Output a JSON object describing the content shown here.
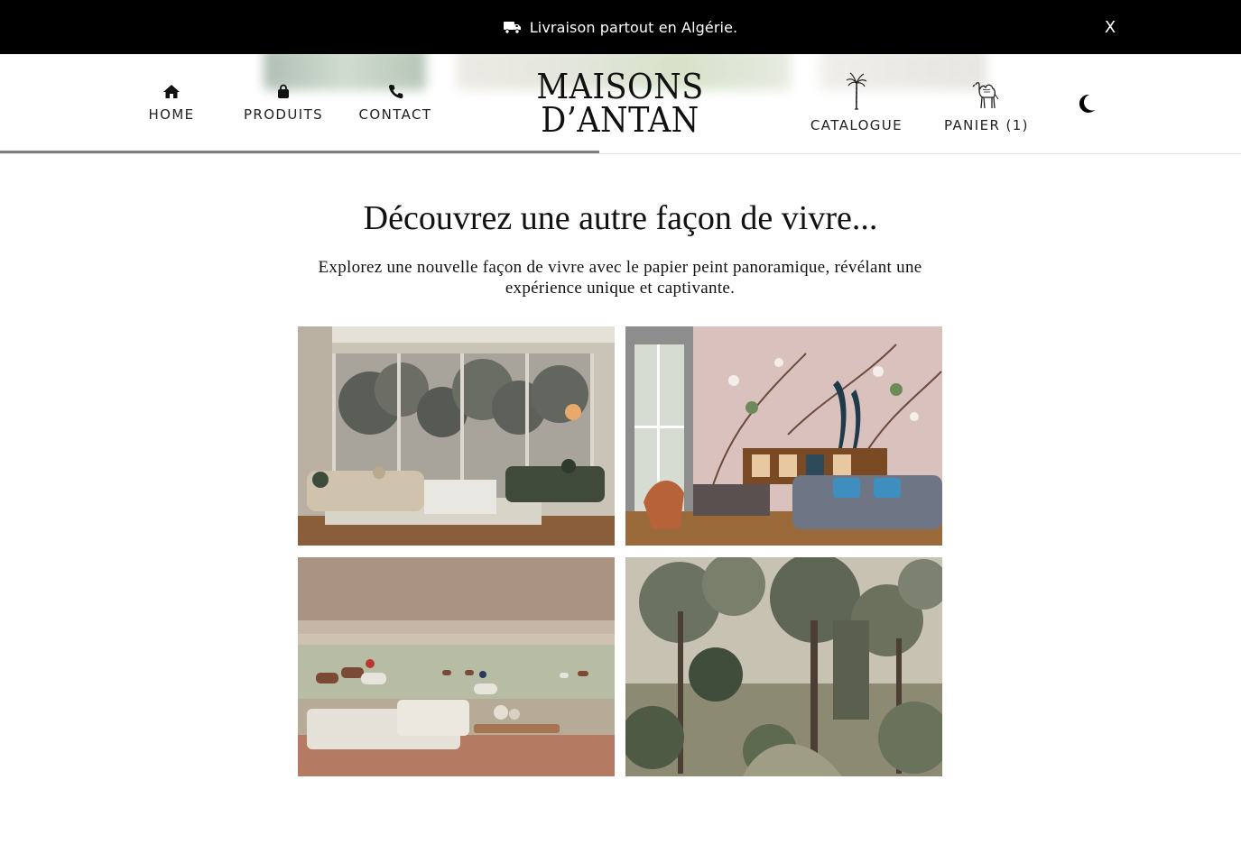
{
  "announcement": {
    "icon": "truck-icon",
    "text": "Livraison partout en Algérie.",
    "close_label": "X"
  },
  "nav": {
    "left": [
      {
        "label": "HOME",
        "icon": "home-icon"
      },
      {
        "label": "PRODUITS",
        "icon": "shopping-bag-icon"
      },
      {
        "label": "CONTACT",
        "icon": "phone-icon"
      }
    ],
    "right": [
      {
        "label": "CATALOGUE",
        "icon": "palm-tree-icon"
      },
      {
        "label": "PANIER (1)",
        "icon": "camel-icon"
      }
    ],
    "theme_toggle_icon": "moon-icon"
  },
  "logo": {
    "line1": "MAISONS",
    "line2": "D’ANTAN"
  },
  "hero": {
    "title": "Découvrez une autre façon de vivre...",
    "subtitle": "Explorez une nouvelle façon de vivre avec le papier peint panoramique, révélant une expérience unique et captivante."
  },
  "gallery": {
    "images": [
      {
        "subject": "living-room-forest-mural"
      },
      {
        "subject": "pink-peacock-chinoiserie-room"
      },
      {
        "subject": "horse-race-mural-living-room"
      },
      {
        "subject": "forest-landscape-mural"
      }
    ]
  },
  "colors": {
    "announcement_bg": "#000000",
    "text": "#111111",
    "progress_line": "#7d7d7d"
  }
}
